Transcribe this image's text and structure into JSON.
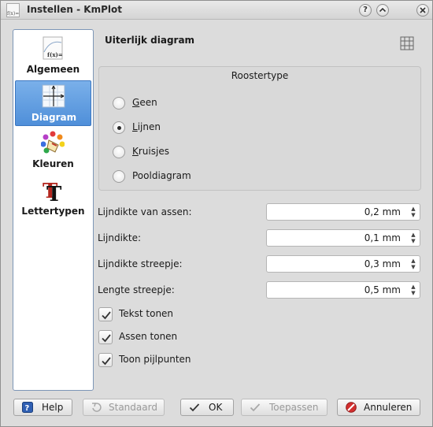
{
  "window": {
    "title": "Instellen - KmPlot"
  },
  "sidebar": {
    "items": [
      {
        "label": "Algemeen",
        "icon": "function-icon"
      },
      {
        "label": "Diagram",
        "icon": "axes-icon",
        "active": true
      },
      {
        "label": "Kleuren",
        "icon": "palette-icon"
      },
      {
        "label": "Lettertypen",
        "icon": "font-icon"
      }
    ]
  },
  "page": {
    "title": "Uiterlijk diagram",
    "icon": "grid-icon"
  },
  "grid_type": {
    "title": "Roostertype",
    "options": [
      {
        "label": "Geen",
        "checked": false
      },
      {
        "label": "Lijnen",
        "checked": true
      },
      {
        "label": "Kruisjes",
        "checked": false
      },
      {
        "label": "Pooldiagram",
        "checked": false
      }
    ]
  },
  "fields": [
    {
      "label": "Lijndikte van assen:",
      "value": "0,2 mm"
    },
    {
      "label": "Lijndikte:",
      "value": "0,1 mm"
    },
    {
      "label": "Lijndikte streepje:",
      "value": "0,3 mm"
    },
    {
      "label": "Lengte streepje:",
      "value": "0,5 mm"
    }
  ],
  "checks": [
    {
      "label": "Tekst tonen",
      "checked": true
    },
    {
      "label": "Assen tonen",
      "checked": true
    },
    {
      "label": "Toon pijlpunten",
      "checked": true
    }
  ],
  "buttons": {
    "help": "Help",
    "defaults": "Standaard",
    "ok": "OK",
    "apply": "Toepassen",
    "cancel": "Annuleren"
  },
  "colors": {
    "accent": "#4f8fd9",
    "background": "#dcdcdc"
  }
}
